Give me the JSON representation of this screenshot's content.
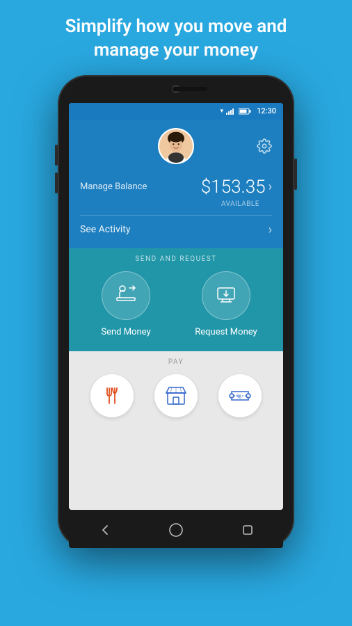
{
  "headline": {
    "line1": "Simplify how you move and",
    "line2": "manage your money"
  },
  "status_bar": {
    "time": "12:30",
    "icons": [
      "signal",
      "network",
      "battery"
    ]
  },
  "profile": {
    "settings_label": "Settings"
  },
  "balance": {
    "label": "Manage Balance",
    "amount": "$153.35",
    "available": "AVAILABLE"
  },
  "activity": {
    "label": "See Activity"
  },
  "send_request": {
    "section_title": "SEND AND REQUEST",
    "send_label": "Send Money",
    "request_label": "Request Money"
  },
  "pay": {
    "section_title": "PAY",
    "items": [
      {
        "label": "Restaurants",
        "icon": "fork-knife"
      },
      {
        "label": "Stores",
        "icon": "store"
      },
      {
        "label": "Tickets",
        "icon": "ticket"
      }
    ]
  },
  "nav": {
    "back_label": "Back",
    "home_label": "Home",
    "recent_label": "Recent"
  },
  "colors": {
    "background": "#29a8e0",
    "top_area": "#1e7fc0",
    "mid_area": "#2196a8",
    "pay_area": "#e8e8e8"
  }
}
